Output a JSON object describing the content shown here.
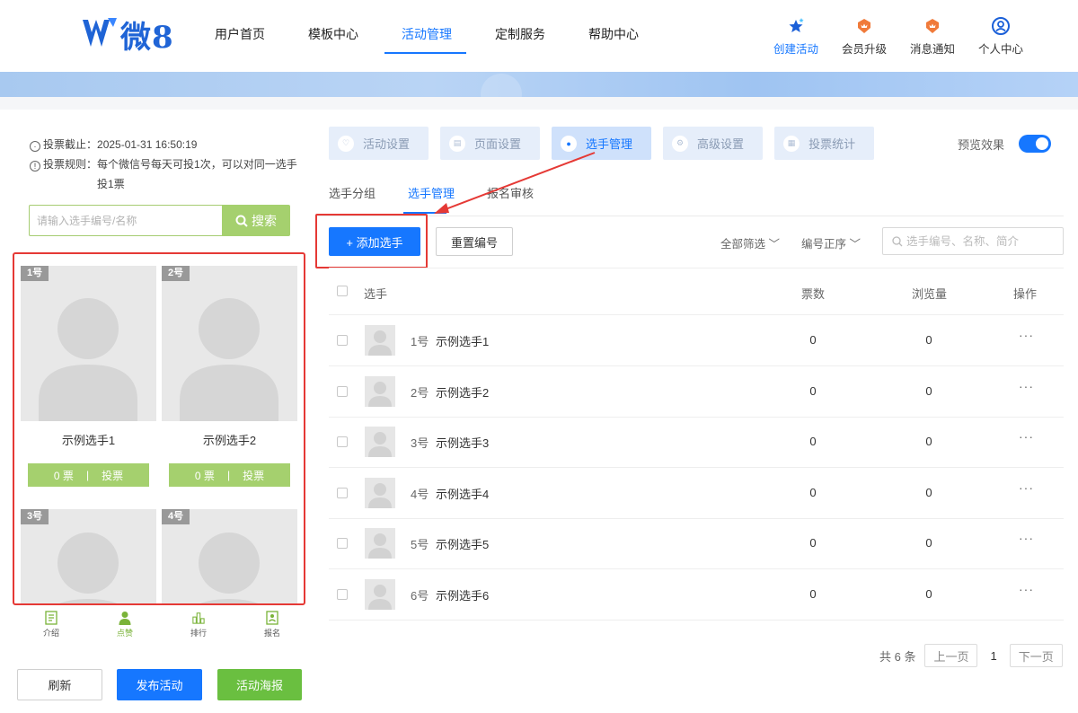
{
  "header": {
    "logo_text": "微8",
    "nav": [
      {
        "label": "用户首页"
      },
      {
        "label": "模板中心"
      },
      {
        "label": "活动管理"
      },
      {
        "label": "定制服务"
      },
      {
        "label": "帮助中心"
      }
    ],
    "active_nav": "活动管理",
    "tools": [
      {
        "label": "创建活动",
        "icon": "star-icon"
      },
      {
        "label": "会员升级",
        "icon": "crown-icon"
      },
      {
        "label": "消息通知",
        "icon": "bell-icon"
      },
      {
        "label": "个人中心",
        "icon": "user-icon"
      }
    ]
  },
  "preview": {
    "deadline_label": "投票截止：",
    "deadline_value": "2025-01-31 16:50:19",
    "rule_label": "投票规则：",
    "rule_value": "每个微信号每天可投1次，可以对同一选手投1票",
    "search_placeholder": "请输入选手编号/名称",
    "search_button": "搜索",
    "cards": [
      {
        "tag": "1号",
        "name": "示例选手1",
        "votes": "0 票",
        "vote_btn": "投票"
      },
      {
        "tag": "2号",
        "name": "示例选手2",
        "votes": "0 票",
        "vote_btn": "投票"
      },
      {
        "tag": "3号",
        "name": "",
        "votes": "",
        "vote_btn": ""
      },
      {
        "tag": "4号",
        "name": "",
        "votes": "",
        "vote_btn": ""
      }
    ],
    "bottom_nav": [
      {
        "label": "介绍",
        "icon": "intro-icon"
      },
      {
        "label": "点赞",
        "icon": "person-icon"
      },
      {
        "label": "排行",
        "icon": "ranking-icon"
      },
      {
        "label": "报名",
        "icon": "signup-icon"
      }
    ],
    "active_bottom_nav": "点赞",
    "buttons": {
      "refresh": "刷新",
      "publish": "发布活动",
      "poster": "活动海报"
    }
  },
  "settings": {
    "tabs": [
      {
        "label": "活动设置"
      },
      {
        "label": "页面设置"
      },
      {
        "label": "选手管理"
      },
      {
        "label": "高级设置"
      },
      {
        "label": "投票统计"
      }
    ],
    "active_tab": "选手管理",
    "preview_label": "预览效果",
    "preview_on": true,
    "subtabs": [
      {
        "label": "选手分组"
      },
      {
        "label": "选手管理"
      },
      {
        "label": "报名审核"
      }
    ],
    "active_subtab": "选手管理"
  },
  "toolbar": {
    "add_label": "+ 添加选手",
    "reset_label": "重置编号",
    "filter_label": "全部筛选",
    "sort_label": "编号正序",
    "search_placeholder": "选手编号、名称、简介"
  },
  "table": {
    "columns": {
      "player": "选手",
      "votes": "票数",
      "views": "浏览量",
      "ops": "操作"
    },
    "rows": [
      {
        "no": "1号",
        "name": "示例选手1",
        "votes": "0",
        "views": "0",
        "op": "···"
      },
      {
        "no": "2号",
        "name": "示例选手2",
        "votes": "0",
        "views": "0",
        "op": "···"
      },
      {
        "no": "3号",
        "name": "示例选手3",
        "votes": "0",
        "views": "0",
        "op": "···"
      },
      {
        "no": "4号",
        "name": "示例选手4",
        "votes": "0",
        "views": "0",
        "op": "···"
      },
      {
        "no": "5号",
        "name": "示例选手5",
        "votes": "0",
        "views": "0",
        "op": "···"
      },
      {
        "no": "6号",
        "name": "示例选手6",
        "votes": "0",
        "views": "0",
        "op": "···"
      }
    ]
  },
  "pager": {
    "total": "共 6 条",
    "prev": "上一页",
    "current": "1",
    "next": "下一页"
  },
  "colors": {
    "primary": "#1677ff",
    "vote_green": "#a5d06e",
    "poster_green": "#6abf40",
    "highlight_red": "#e53935"
  }
}
